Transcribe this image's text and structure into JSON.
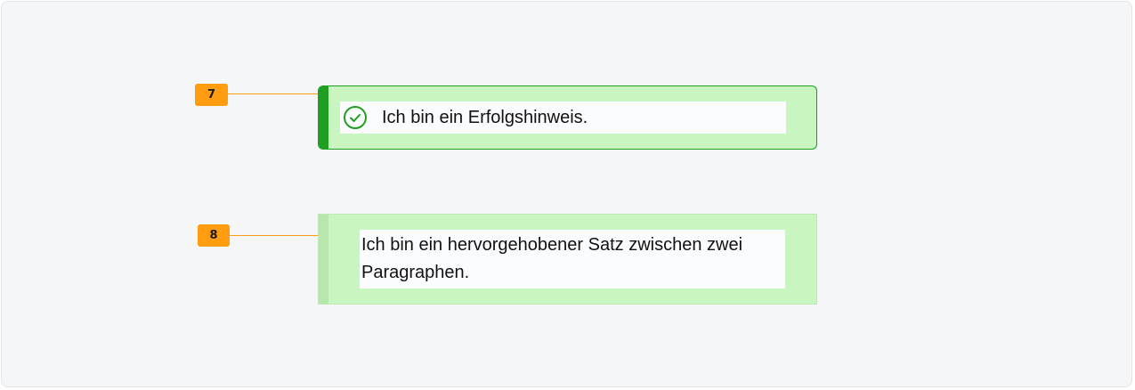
{
  "markers": {
    "first": "7",
    "second": "8"
  },
  "success_alert": {
    "icon": "check-circle-icon",
    "message": "Ich bin ein Erfolgshinweis.",
    "accent_color": "#1f9e22",
    "background_color": "#c9f5c0"
  },
  "highlight_block": {
    "message": "Ich bin ein hervorgehobener Satz zwischen zwei Paragraphen.",
    "background_color": "#c9f5c0"
  },
  "annotation_color": "#ff9c10"
}
